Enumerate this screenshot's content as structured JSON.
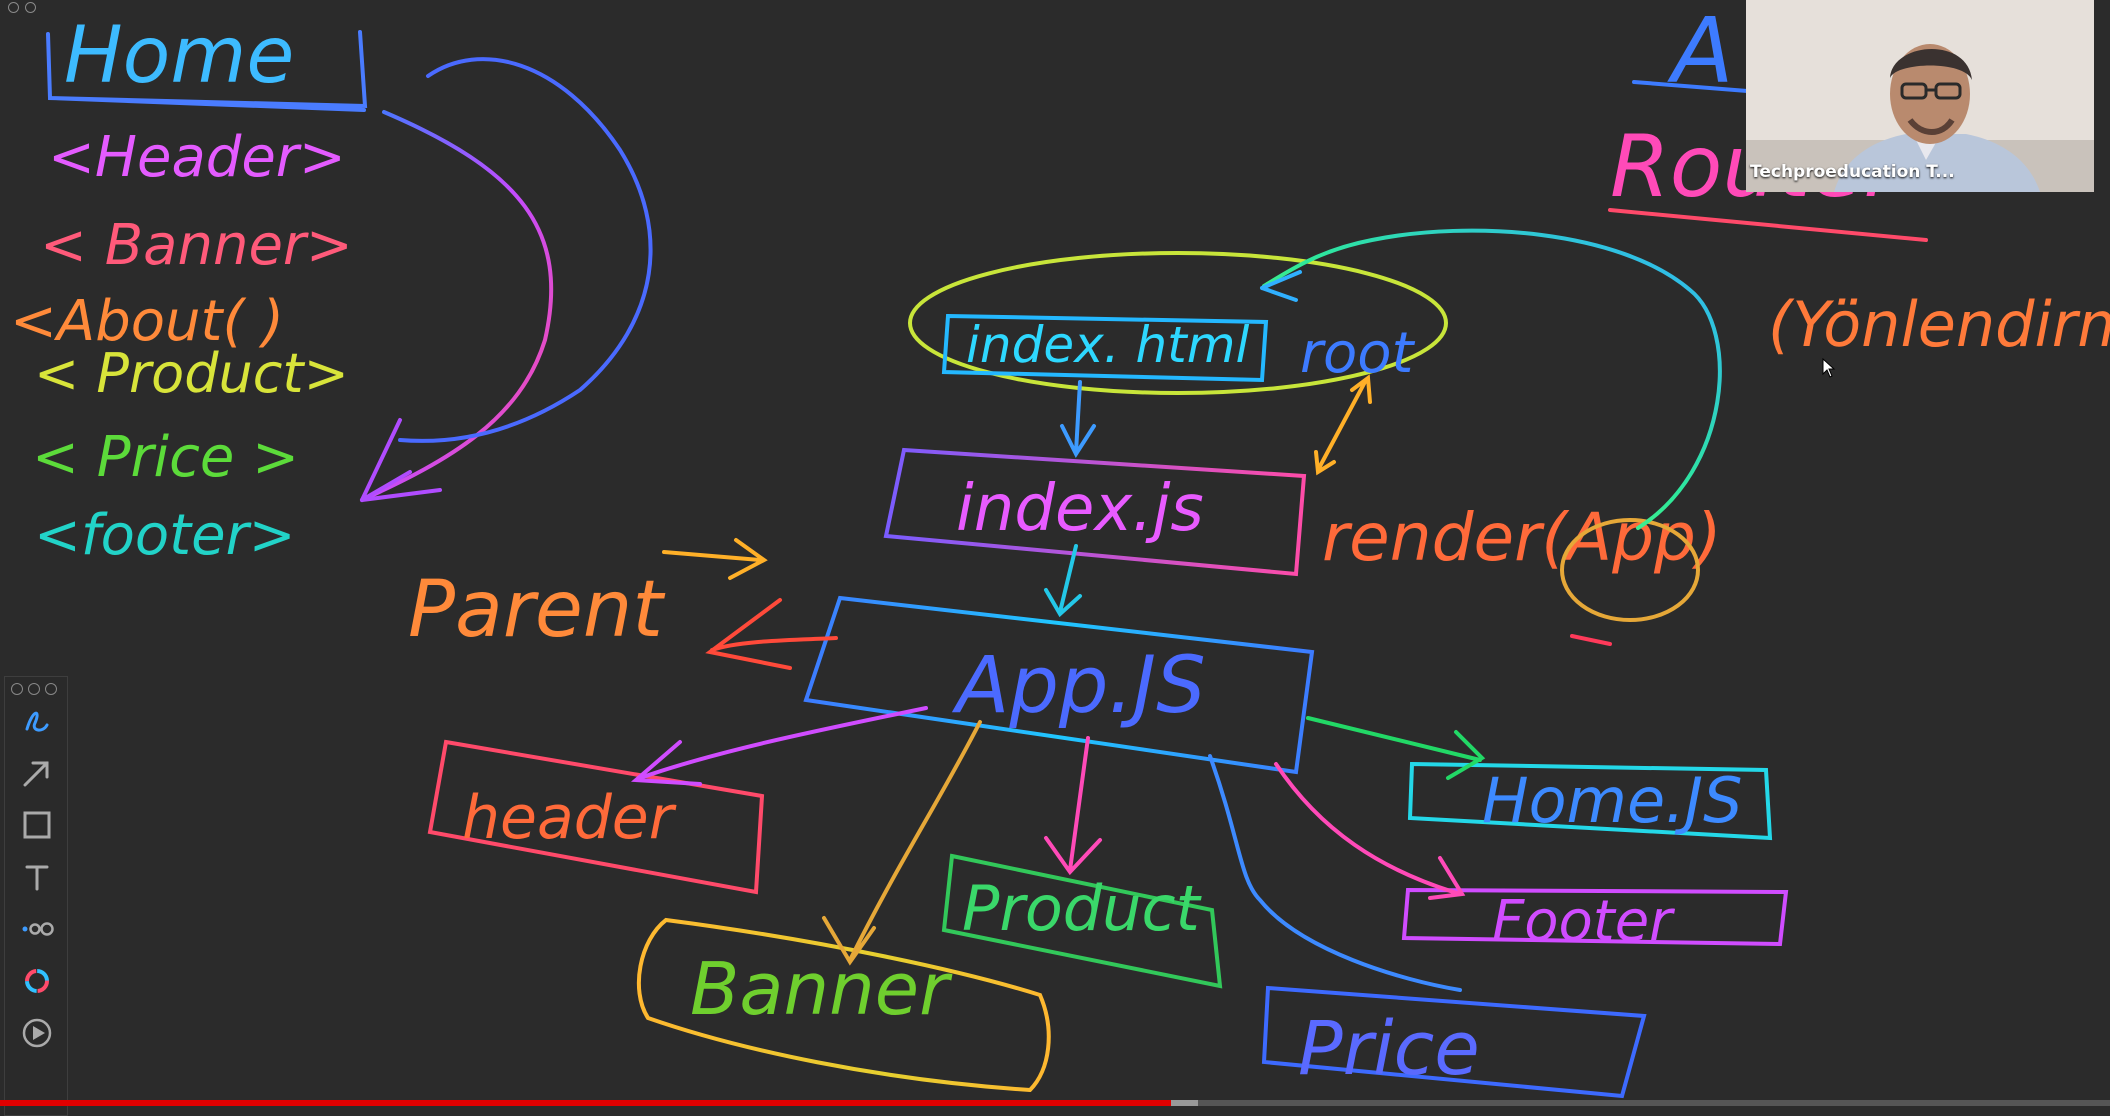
{
  "whiteboard": {
    "left_list": {
      "title": "Home",
      "items": [
        "<Header>",
        "< Banner>",
        "<About( )",
        "< Product>",
        "< Price >",
        "<footer>"
      ]
    },
    "nodes": {
      "index_html": "index. html",
      "root": "root",
      "index_js": "index.js",
      "render": "render(App)",
      "app_js": "App.JS",
      "parent": "Parent",
      "header": "header",
      "banner": "Banner",
      "product": "Product",
      "price": "Price",
      "home_js": "Home.JS",
      "footer": "Footer"
    },
    "router": {
      "top": "A",
      "label": "Router",
      "note": "(Yönlendirme)"
    }
  },
  "toolbar": {
    "tools": [
      "pen-icon",
      "arrow-icon",
      "rectangle-icon",
      "text-icon",
      "dots-icon",
      "color-picker-icon",
      "play-icon"
    ]
  },
  "webcam": {
    "name": "Techproeducation T..."
  },
  "player": {
    "progress": 0.555,
    "buffered": 0.568
  },
  "colors": {
    "background": "#2b2b2b",
    "progress": "#e00000"
  }
}
